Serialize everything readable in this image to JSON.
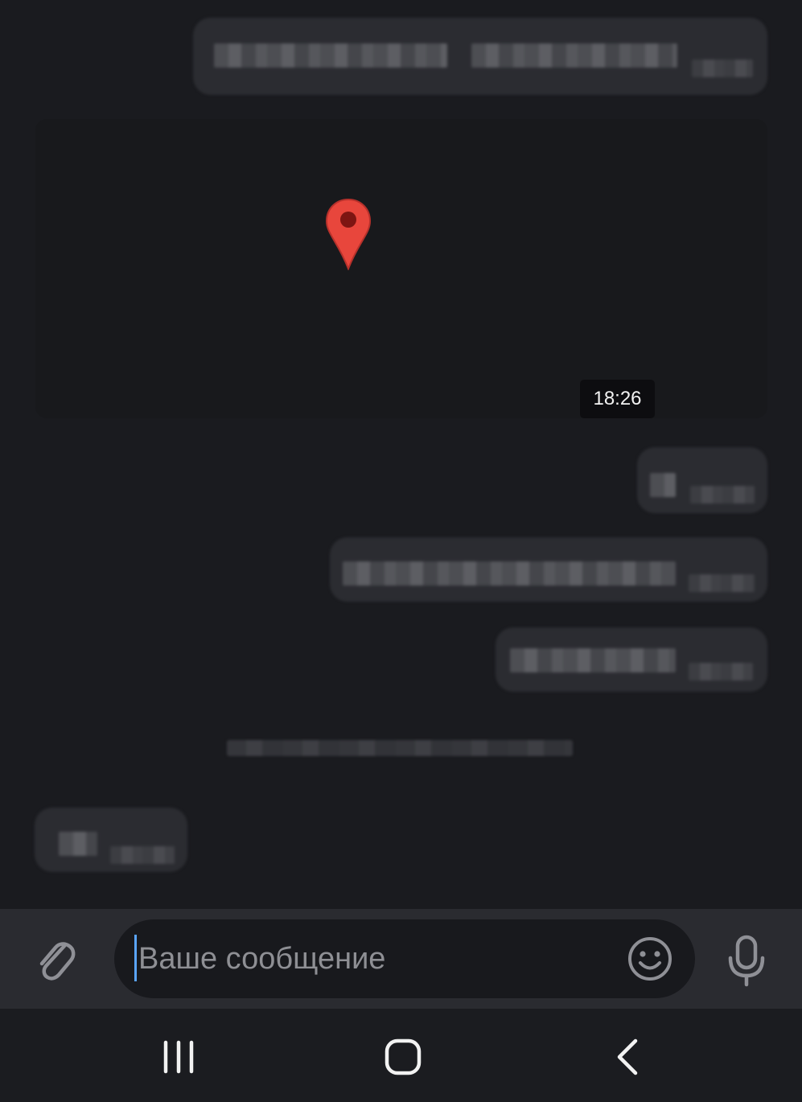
{
  "messages": {
    "time_label": "18:26"
  },
  "composer": {
    "placeholder": "Ваше сообщение",
    "attach_icon": "paperclip-icon",
    "emoji_icon": "emoji-icon",
    "mic_icon": "microphone-icon"
  },
  "location": {
    "pin_icon": "map-pin-icon",
    "pin_color": "#e8463c"
  },
  "nav": {
    "recents_icon": "recents-icon",
    "home_icon": "home-icon",
    "back_icon": "back-icon"
  },
  "colors": {
    "background": "#1a1b1f",
    "bubble": "#2b2c31",
    "input_bar": "#2a2b30",
    "caret": "#5aa5ff"
  }
}
